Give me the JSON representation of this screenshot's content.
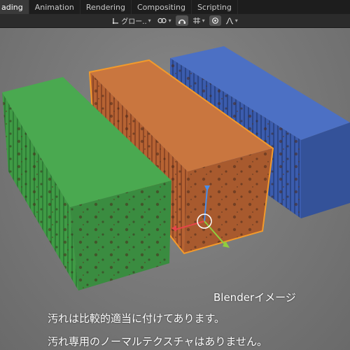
{
  "tabs": [
    {
      "label": "ading",
      "active": true
    },
    {
      "label": "Animation",
      "active": false
    },
    {
      "label": "Rendering",
      "active": false
    },
    {
      "label": "Compositing",
      "active": false
    },
    {
      "label": "Scripting",
      "active": false
    }
  ],
  "toolbar": {
    "orientation_label": "グロー..",
    "pivot_icon": "pivot-icon",
    "snap_icon": "snap-icon",
    "proportional_icon": "proportional-editing-icon",
    "falloff_icon": "falloff-curve-icon"
  },
  "scene": {
    "containers": [
      {
        "name": "green-container",
        "color": "#3e9a44"
      },
      {
        "name": "orange-container",
        "color": "#c06a35",
        "selected": true
      },
      {
        "name": "blue-container",
        "color": "#3d5fb0"
      }
    ],
    "selection_outline_color": "#f39a2b",
    "gizmo_colors": {
      "x": "#e8454a",
      "y": "#8fcf3e",
      "z": "#4a8ee8"
    }
  },
  "captions": {
    "line1": "Blenderイメージ",
    "line2": "汚れは比較的適当に付けてあります。",
    "line3": "汚れ専用のノーマルテクスチャはありません。"
  }
}
